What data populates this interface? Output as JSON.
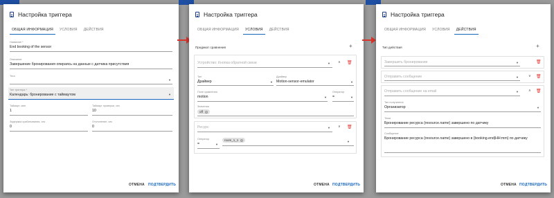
{
  "colors": {
    "accent": "#1565c0",
    "danger": "#e53935",
    "arrow": "#d9342b"
  },
  "bg_strips": [
    "",
    "",
    ""
  ],
  "panel1": {
    "title": "Настройка триггера",
    "tabs": [
      "Общая информация",
      "Условия",
      "Действия"
    ],
    "active_tab": 0,
    "fields": {
      "name": {
        "label": "Название *",
        "value": "End booking of the sensor"
      },
      "description": {
        "label": "Описание",
        "value": "Завершение бронирования опираясь на данные с датчика присутствия"
      },
      "group": {
        "label": "Тега",
        "value": ""
      },
      "trigger_type": {
        "label": "Тип триггера *",
        "value": "Календарь: бронирование с таймаутом"
      },
      "timeout": {
        "label": "Таймаут, мин",
        "value": "1"
      },
      "check_timeout": {
        "label": "Таймаут проверки, сек",
        "value": "10"
      },
      "activation_delay": {
        "label": "Задержка срабатывания, сек",
        "value": "0"
      },
      "deviation": {
        "label": "Отклонение, сек",
        "value": "0"
      }
    },
    "cancel": "Отмена",
    "confirm": "Подтвердить"
  },
  "panel2": {
    "title": "Настройка триггера",
    "tabs": [
      "Общая информация",
      "Условия",
      "Действия"
    ],
    "active_tab": 1,
    "section_label": "Предикат сравнения",
    "card1": {
      "device_placeholder": "Устройство: Кнопка обратной связи",
      "type_label": "Тип",
      "type_value": "Драйвер",
      "driver_label": "Драйвер",
      "driver_value": "Motion-sensor-emulator",
      "field_label": "Поле сравнения",
      "field_value": "motion",
      "operator_label": "Оператор",
      "operator_value": "=",
      "values_label": "Значения",
      "chip": "off"
    },
    "card2": {
      "resource_placeholder": "Ресурс",
      "operator_label": "Оператор",
      "operator_value": "=",
      "chip": "room_1_1"
    },
    "cancel": "Отмена",
    "confirm": "Подтвердить"
  },
  "panel3": {
    "title": "Настройка триггера",
    "tabs": [
      "Общая информация",
      "Условия",
      "Действия"
    ],
    "active_tab": 2,
    "section_label": "Тип действия",
    "rows": [
      "Завершить бронирование",
      "Отправить сообщение",
      "Отправить сообщение на email"
    ],
    "recipient_type_label": "Тип получателя",
    "recipient_type_value": "Организатор",
    "subject_label": "Тема",
    "subject_value": "Бронирование ресурса {resource.name} завершено по датчику",
    "message_label": "Сообщение",
    "message_value": "Бронирование ресурса {resource.name} завершено в {booking.end|HH:mm} по датчику",
    "cancel": "Отмена",
    "confirm": "Подтвердить"
  }
}
